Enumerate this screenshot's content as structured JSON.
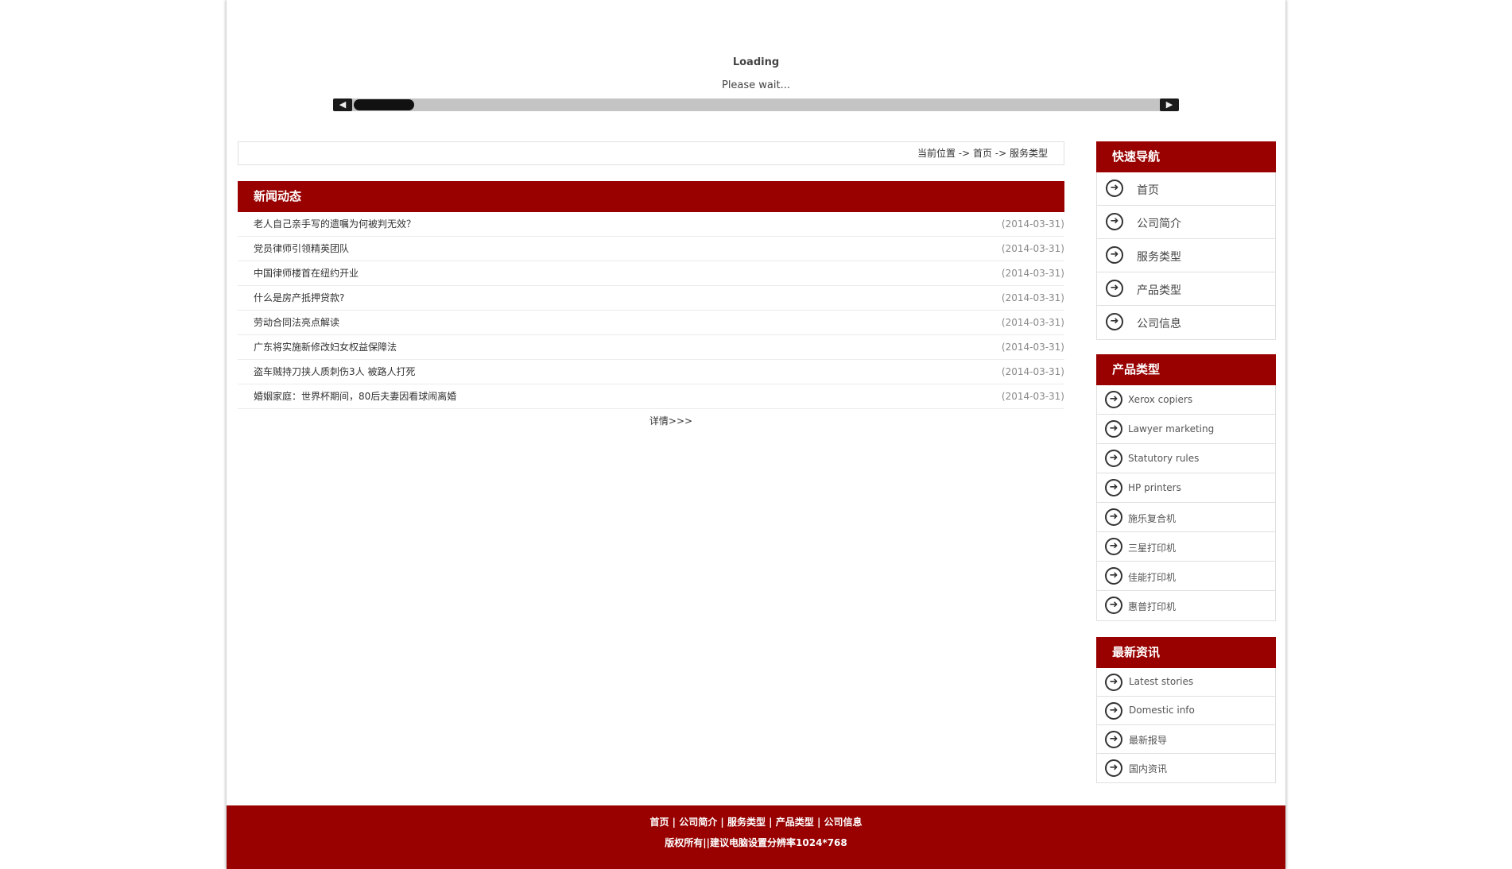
{
  "loading": {
    "title": "Loading",
    "subtitle": "Please wait...",
    "scroll_left_icon": "◀",
    "scroll_right_icon": "▶"
  },
  "breadcrumb": {
    "text": "当前位置 -> 首页 -> 服务类型"
  },
  "news": {
    "heading": "新闻动态",
    "items": [
      {
        "title": "老人自己亲手写的遗嘱为何被判无效？",
        "date": "(2014-03-31)"
      },
      {
        "title": "党员律师引领精英团队",
        "date": "(2014-03-31)"
      },
      {
        "title": "中国律师楼首在纽约开业",
        "date": "(2014-03-31)"
      },
      {
        "title": "什么是房产抵押贷款?",
        "date": "(2014-03-31)"
      },
      {
        "title": "劳动合同法亮点解读",
        "date": "(2014-03-31)"
      },
      {
        "title": "广东将实施新修改妇女权益保障法",
        "date": "(2014-03-31)"
      },
      {
        "title": "盗车贼持刀挟人质刺伤3人 被路人打死",
        "date": "(2014-03-31)"
      },
      {
        "title": "婚姻家庭：世界杯期间，80后夫妻因看球闹离婚",
        "date": "(2014-03-31)"
      }
    ],
    "more": "详情>>>"
  },
  "quick_nav": {
    "heading": "快速导航",
    "items": [
      {
        "label": "首页"
      },
      {
        "label": "公司简介"
      },
      {
        "label": "服务类型"
      },
      {
        "label": "产品类型"
      },
      {
        "label": "公司信息"
      }
    ]
  },
  "product_types": {
    "heading": "产品类型",
    "items": [
      {
        "label": "Xerox copiers"
      },
      {
        "label": "Lawyer marketing"
      },
      {
        "label": "Statutory rules"
      },
      {
        "label": "HP printers"
      },
      {
        "label": "施乐复合机"
      },
      {
        "label": "三星打印机"
      },
      {
        "label": "佳能打印机"
      },
      {
        "label": "惠普打印机"
      }
    ]
  },
  "latest_news": {
    "heading": "最新资讯",
    "items": [
      {
        "label": "Latest stories"
      },
      {
        "label": "Domestic info"
      },
      {
        "label": "最新报导"
      },
      {
        "label": "国内资讯"
      }
    ]
  },
  "footer": {
    "links": [
      "首页",
      "公司简介",
      "服务类型",
      "产品类型",
      "公司信息"
    ],
    "separator": " | ",
    "copyright": "版权所有||建议电脑设置分辨率1024*768"
  },
  "icons": {
    "arrow": "➜"
  },
  "colors": {
    "accent": "#990000"
  }
}
